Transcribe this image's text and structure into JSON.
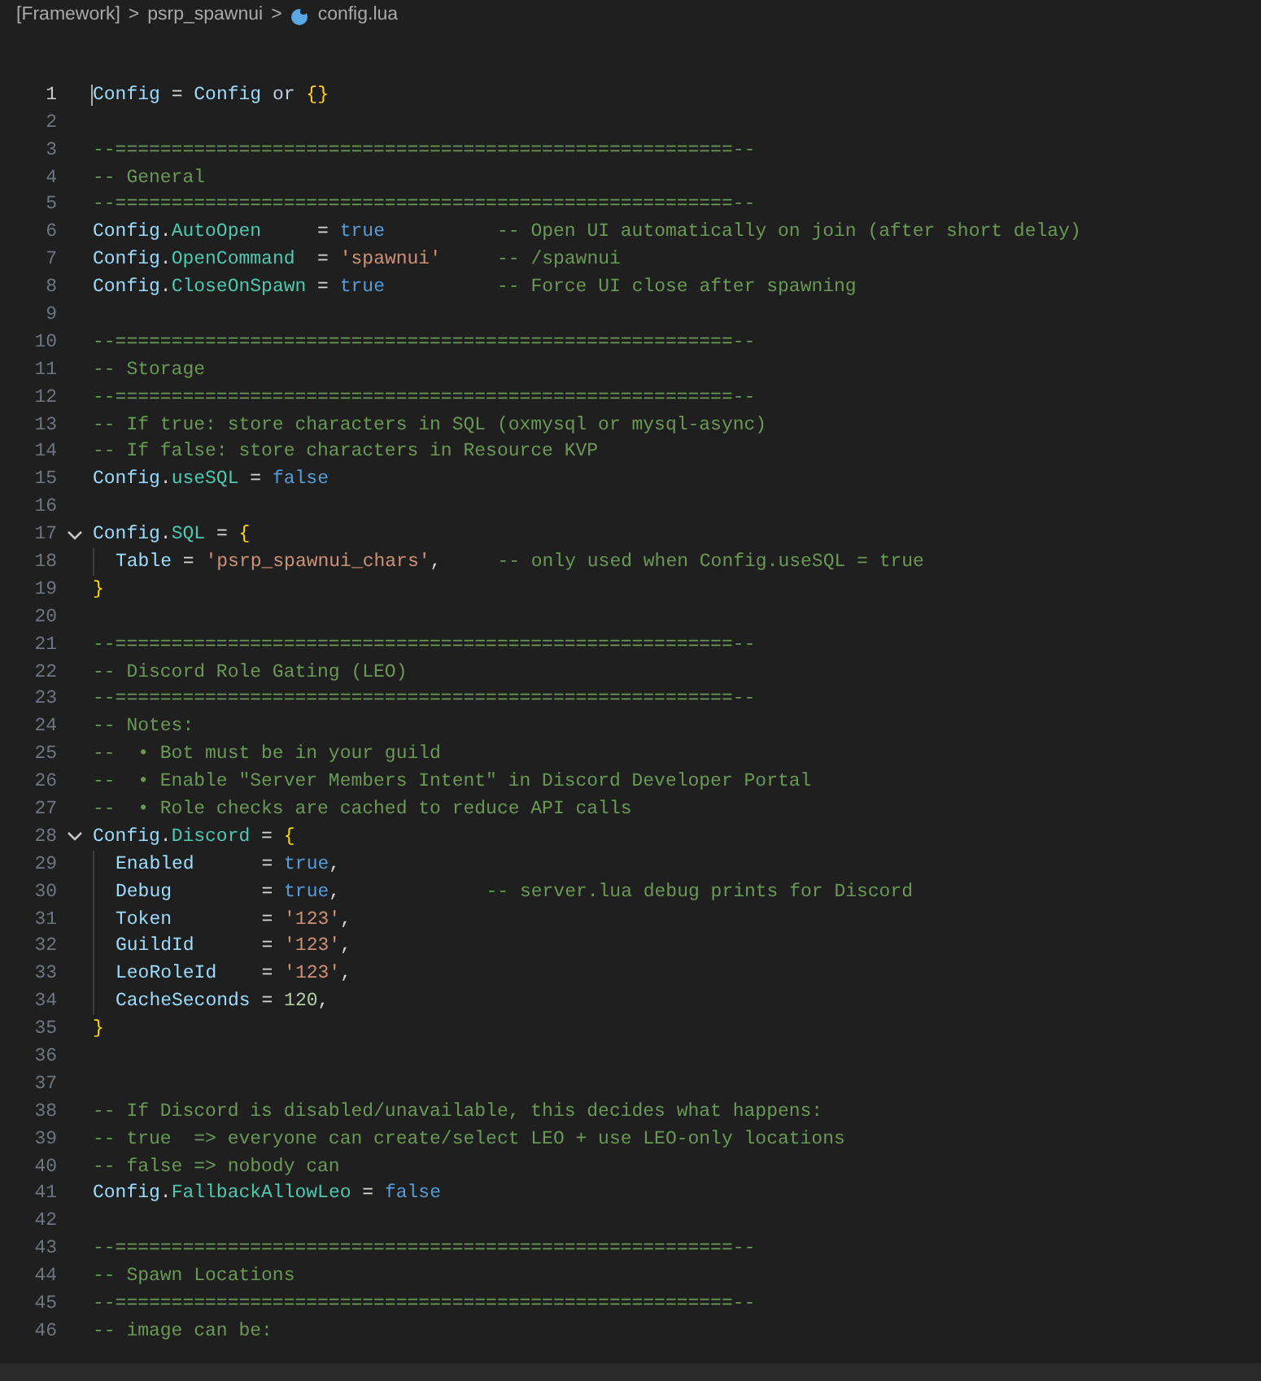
{
  "breadcrumb": {
    "items": [
      "[Framework]",
      "psrp_spawnui",
      "config.lua"
    ],
    "separator": ">"
  },
  "lines": [
    {
      "number": "1",
      "current": true,
      "tokens": [
        {
          "kind": "global",
          "text": "Config"
        },
        {
          "kind": "punct",
          "text": " = "
        },
        {
          "kind": "global",
          "text": "Config"
        },
        {
          "kind": "keyword",
          "text": " or "
        },
        {
          "kind": "brace",
          "text": "{}"
        }
      ]
    },
    {
      "number": "2"
    },
    {
      "number": "3",
      "tokens": [
        {
          "kind": "comment",
          "text": "--=======================================================--"
        }
      ]
    },
    {
      "number": "4",
      "tokens": [
        {
          "kind": "comment",
          "text": "-- General"
        }
      ]
    },
    {
      "number": "5",
      "tokens": [
        {
          "kind": "comment",
          "text": "--=======================================================--"
        }
      ]
    },
    {
      "number": "6",
      "tokens": [
        {
          "kind": "global",
          "text": "Config"
        },
        {
          "kind": "punct",
          "text": "."
        },
        {
          "kind": "field",
          "text": "AutoOpen"
        },
        {
          "kind": "punct",
          "text": "     = "
        },
        {
          "kind": "bool",
          "text": "true          "
        },
        {
          "kind": "comment",
          "text": "-- Open UI automatically on join (after short delay)"
        }
      ]
    },
    {
      "number": "7",
      "tokens": [
        {
          "kind": "global",
          "text": "Config"
        },
        {
          "kind": "punct",
          "text": "."
        },
        {
          "kind": "field",
          "text": "OpenCommand"
        },
        {
          "kind": "punct",
          "text": "  = "
        },
        {
          "kind": "string",
          "text": "'spawnui'     "
        },
        {
          "kind": "comment",
          "text": "-- /spawnui"
        }
      ]
    },
    {
      "number": "8",
      "tokens": [
        {
          "kind": "global",
          "text": "Config"
        },
        {
          "kind": "punct",
          "text": "."
        },
        {
          "kind": "field",
          "text": "CloseOnSpawn"
        },
        {
          "kind": "punct",
          "text": " = "
        },
        {
          "kind": "bool",
          "text": "true          "
        },
        {
          "kind": "comment",
          "text": "-- Force UI close after spawning"
        }
      ]
    },
    {
      "number": "9"
    },
    {
      "number": "10",
      "tokens": [
        {
          "kind": "comment",
          "text": "--=======================================================--"
        }
      ]
    },
    {
      "number": "11",
      "tokens": [
        {
          "kind": "comment",
          "text": "-- Storage"
        }
      ]
    },
    {
      "number": "12",
      "tokens": [
        {
          "kind": "comment",
          "text": "--=======================================================--"
        }
      ]
    },
    {
      "number": "13",
      "tokens": [
        {
          "kind": "comment",
          "text": "-- If true: store characters in SQL (oxmysql or mysql-async)"
        }
      ]
    },
    {
      "number": "14",
      "tokens": [
        {
          "kind": "comment",
          "text": "-- If false: store characters in Resource KVP"
        }
      ]
    },
    {
      "number": "15",
      "tokens": [
        {
          "kind": "global",
          "text": "Config"
        },
        {
          "kind": "punct",
          "text": "."
        },
        {
          "kind": "field",
          "text": "useSQL"
        },
        {
          "kind": "punct",
          "text": " = "
        },
        {
          "kind": "bool",
          "text": "false"
        }
      ]
    },
    {
      "number": "16"
    },
    {
      "number": "17",
      "folded": false,
      "tokens": [
        {
          "kind": "global",
          "text": "Config"
        },
        {
          "kind": "punct",
          "text": "."
        },
        {
          "kind": "field",
          "text": "SQL"
        },
        {
          "kind": "punct",
          "text": " = "
        },
        {
          "kind": "brace",
          "text": "{"
        }
      ]
    },
    {
      "number": "18",
      "guide": true,
      "tokens": [
        {
          "kind": "key",
          "text": "Table"
        },
        {
          "kind": "punct",
          "text": " = "
        },
        {
          "kind": "string",
          "text": "'psrp_spawnui_chars'"
        },
        {
          "kind": "punct",
          "text": ",     "
        },
        {
          "kind": "comment",
          "text": "-- only used when Config.useSQL = true"
        }
      ]
    },
    {
      "number": "19",
      "tokens": [
        {
          "kind": "brace",
          "text": "}"
        }
      ]
    },
    {
      "number": "20"
    },
    {
      "number": "21",
      "tokens": [
        {
          "kind": "comment",
          "text": "--=======================================================--"
        }
      ]
    },
    {
      "number": "22",
      "tokens": [
        {
          "kind": "comment",
          "text": "-- Discord Role Gating (LEO)"
        }
      ]
    },
    {
      "number": "23",
      "tokens": [
        {
          "kind": "comment",
          "text": "--=======================================================--"
        }
      ]
    },
    {
      "number": "24",
      "tokens": [
        {
          "kind": "comment",
          "text": "-- Notes:"
        }
      ]
    },
    {
      "number": "25",
      "tokens": [
        {
          "kind": "comment",
          "text": "--  • Bot must be in your guild"
        }
      ]
    },
    {
      "number": "26",
      "tokens": [
        {
          "kind": "comment",
          "text": "--  • Enable \"Server Members Intent\" in Discord Developer Portal"
        }
      ]
    },
    {
      "number": "27",
      "tokens": [
        {
          "kind": "comment",
          "text": "--  • Role checks are cached to reduce API calls"
        }
      ]
    },
    {
      "number": "28",
      "folded": false,
      "tokens": [
        {
          "kind": "global",
          "text": "Config"
        },
        {
          "kind": "punct",
          "text": "."
        },
        {
          "kind": "field",
          "text": "Discord"
        },
        {
          "kind": "punct",
          "text": " = "
        },
        {
          "kind": "brace",
          "text": "{"
        }
      ]
    },
    {
      "number": "29",
      "guide": true,
      "tokens": [
        {
          "kind": "key",
          "text": "Enabled"
        },
        {
          "kind": "punct",
          "text": "      = "
        },
        {
          "kind": "bool",
          "text": "true"
        },
        {
          "kind": "punct",
          "text": ","
        }
      ]
    },
    {
      "number": "30",
      "guide": true,
      "tokens": [
        {
          "kind": "key",
          "text": "Debug"
        },
        {
          "kind": "punct",
          "text": "        = "
        },
        {
          "kind": "bool",
          "text": "true"
        },
        {
          "kind": "punct",
          "text": ",             "
        },
        {
          "kind": "comment",
          "text": "-- server.lua debug prints for Discord"
        }
      ]
    },
    {
      "number": "31",
      "guide": true,
      "tokens": [
        {
          "kind": "key",
          "text": "Token"
        },
        {
          "kind": "punct",
          "text": "        = "
        },
        {
          "kind": "string",
          "text": "'123'"
        },
        {
          "kind": "punct",
          "text": ","
        }
      ]
    },
    {
      "number": "32",
      "guide": true,
      "tokens": [
        {
          "kind": "key",
          "text": "GuildId"
        },
        {
          "kind": "punct",
          "text": "      = "
        },
        {
          "kind": "string",
          "text": "'123'"
        },
        {
          "kind": "punct",
          "text": ","
        }
      ]
    },
    {
      "number": "33",
      "guide": true,
      "tokens": [
        {
          "kind": "key",
          "text": "LeoRoleId"
        },
        {
          "kind": "punct",
          "text": "    = "
        },
        {
          "kind": "string",
          "text": "'123'"
        },
        {
          "kind": "punct",
          "text": ","
        }
      ]
    },
    {
      "number": "34",
      "guide": true,
      "tokens": [
        {
          "kind": "key",
          "text": "CacheSeconds"
        },
        {
          "kind": "punct",
          "text": " = "
        },
        {
          "kind": "number",
          "text": "120"
        },
        {
          "kind": "punct",
          "text": ","
        }
      ]
    },
    {
      "number": "35",
      "tokens": [
        {
          "kind": "brace",
          "text": "}"
        }
      ]
    },
    {
      "number": "36"
    },
    {
      "number": "37"
    },
    {
      "number": "38",
      "tokens": [
        {
          "kind": "comment",
          "text": "-- If Discord is disabled/unavailable, this decides what happens:"
        }
      ]
    },
    {
      "number": "39",
      "tokens": [
        {
          "kind": "comment",
          "text": "-- true  => everyone can create/select LEO + use LEO-only locations"
        }
      ]
    },
    {
      "number": "40",
      "tokens": [
        {
          "kind": "comment",
          "text": "-- false => nobody can"
        }
      ]
    },
    {
      "number": "41",
      "tokens": [
        {
          "kind": "global",
          "text": "Config"
        },
        {
          "kind": "punct",
          "text": "."
        },
        {
          "kind": "field",
          "text": "FallbackAllowLeo"
        },
        {
          "kind": "punct",
          "text": " = "
        },
        {
          "kind": "bool",
          "text": "false"
        }
      ]
    },
    {
      "number": "42"
    },
    {
      "number": "43",
      "tokens": [
        {
          "kind": "comment",
          "text": "--=======================================================--"
        }
      ]
    },
    {
      "number": "44",
      "tokens": [
        {
          "kind": "comment",
          "text": "-- Spawn Locations"
        }
      ]
    },
    {
      "number": "45",
      "tokens": [
        {
          "kind": "comment",
          "text": "--=======================================================--"
        }
      ]
    },
    {
      "number": "46",
      "tokens": [
        {
          "kind": "comment",
          "text": "-- image can be:"
        }
      ]
    }
  ]
}
